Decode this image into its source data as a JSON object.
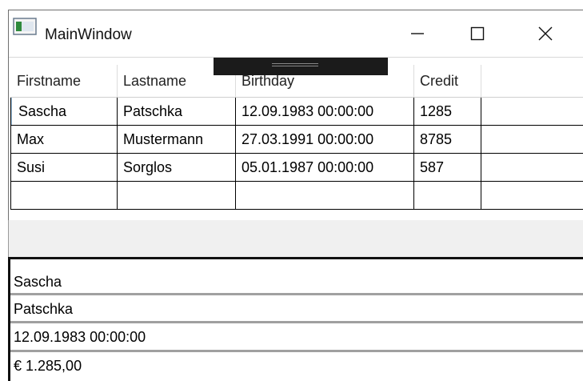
{
  "window": {
    "title": "MainWindow"
  },
  "grid": {
    "columns": [
      "Firstname",
      "Lastname",
      "Birthday",
      "Credit"
    ],
    "rows": [
      [
        "Sascha",
        "Patschka",
        "12.09.1983 00:00:00",
        "1285"
      ],
      [
        "Max",
        "Mustermann",
        "27.03.1991 00:00:00",
        "8785"
      ],
      [
        "Susi",
        "Sorglos",
        "05.01.1987 00:00:00",
        "587"
      ],
      [
        "",
        "",
        "",
        ""
      ]
    ]
  },
  "details": {
    "firstname": "Sascha",
    "lastname": "Patschka",
    "birthday": "12.09.1983 00:00:00",
    "credit": "€ 1.285,00"
  }
}
